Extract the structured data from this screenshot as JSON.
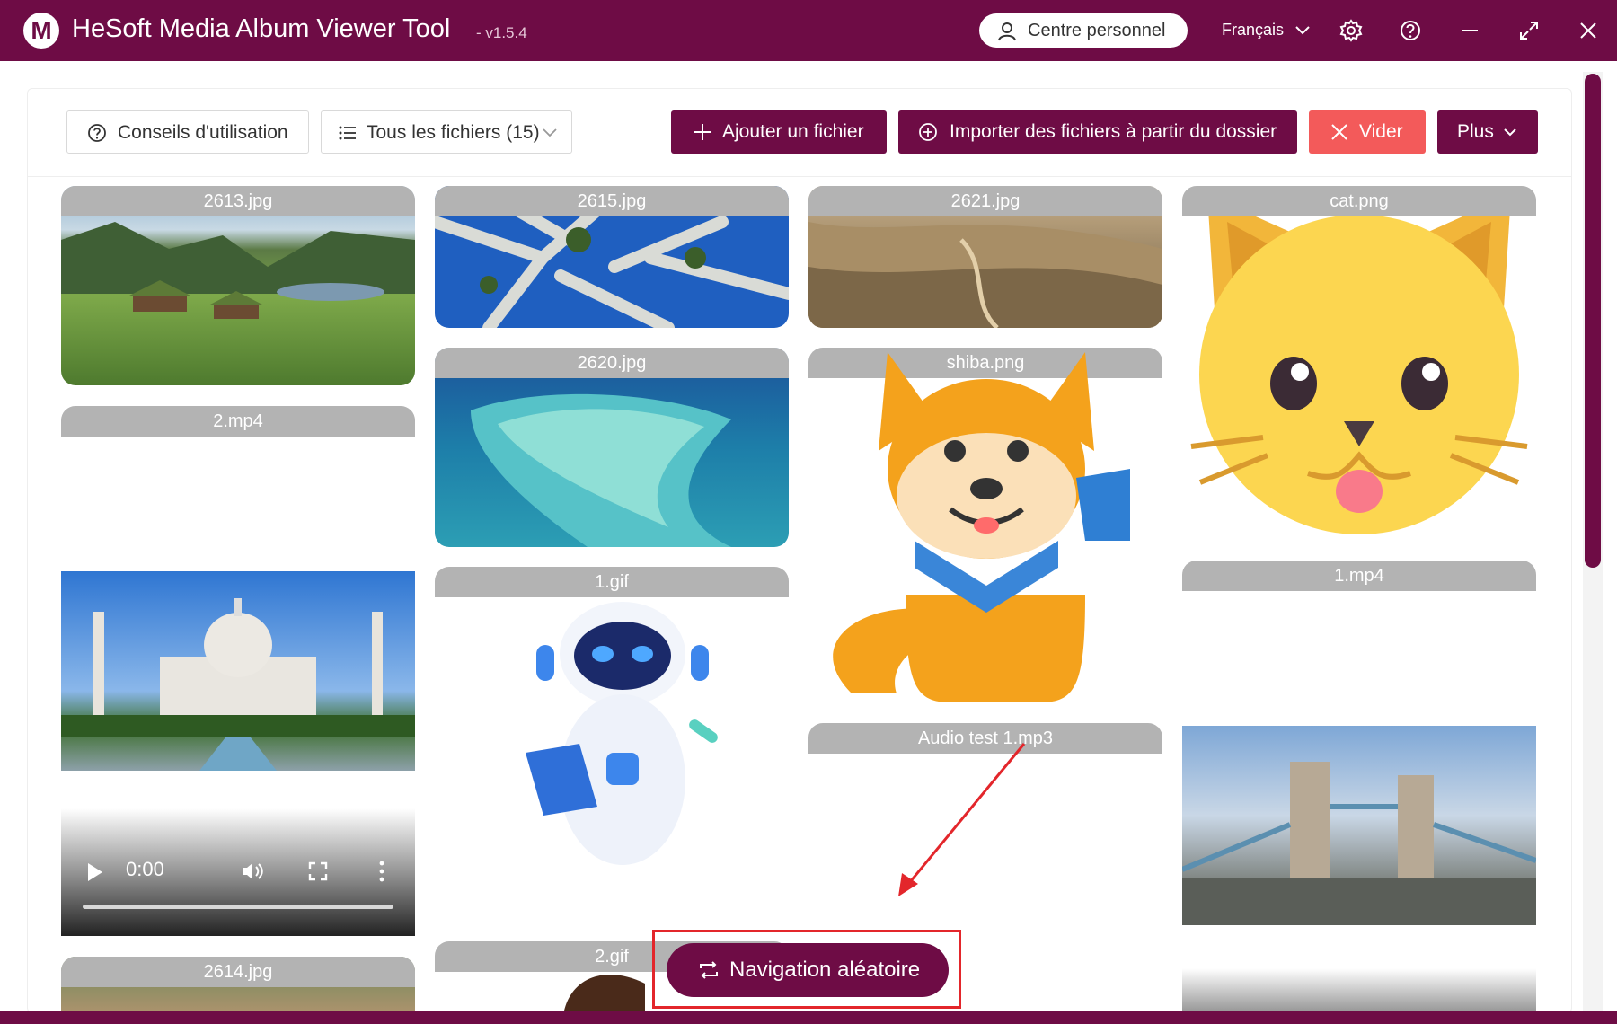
{
  "window": {
    "title": "HeSoft Media Album Viewer Tool",
    "version": "- v1.5.4",
    "logo_letter": "M",
    "personal_center": "Centre personnel",
    "language": "Français",
    "accent": "#6e0c45"
  },
  "toolbar": {
    "tips_label": "Conseils d'utilisation",
    "filter_label": "Tous les fichiers (15)",
    "add_file_label": "Ajouter un fichier",
    "import_folder_label": "Importer des fichiers à partir du dossier",
    "clear_label": "Vider",
    "more_label": "Plus"
  },
  "tiles": {
    "t2613": "2613.jpg",
    "t2615": "2615.jpg",
    "t2621": "2621.jpg",
    "cat": "cat.png",
    "v2": "2.mp4",
    "t2620": "2620.jpg",
    "shiba": "shiba.png",
    "gif1": "1.gif",
    "v1": "1.mp4",
    "audio": "Audio test 1.mp3",
    "t2614": "2614.jpg",
    "gif2": "2.gif"
  },
  "video_player": {
    "time": "0:00"
  },
  "random_nav_label": "Navigation aléatoire",
  "icons": {
    "user": "user-icon",
    "settings": "gear-icon",
    "help": "help-icon",
    "minimize": "minimize-icon",
    "maximize": "maximize-icon",
    "close": "close-icon"
  }
}
